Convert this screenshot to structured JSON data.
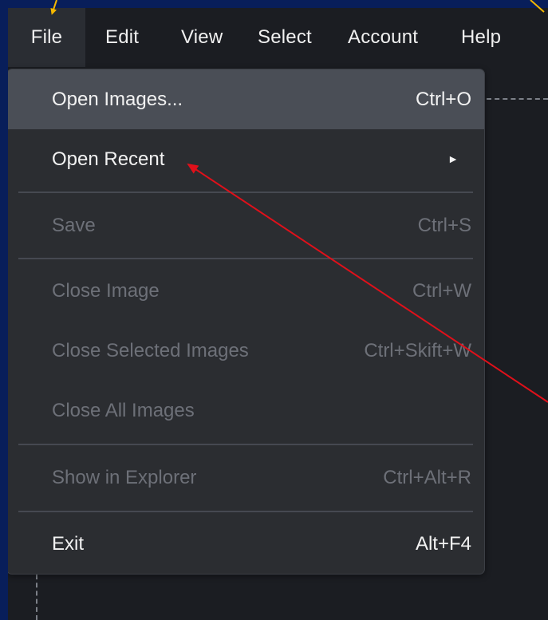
{
  "menubar": {
    "items": [
      {
        "label": "File",
        "active": true
      },
      {
        "label": "Edit"
      },
      {
        "label": "View"
      },
      {
        "label": "Select"
      },
      {
        "label": "Account"
      },
      {
        "label": "Help"
      }
    ]
  },
  "file_menu": {
    "items": [
      {
        "label": "Open Images...",
        "shortcut": "Ctrl+O",
        "enabled": true,
        "highlighted": true
      },
      {
        "label": "Open Recent",
        "submenu_icon": "►",
        "enabled": true
      },
      {
        "label": "Save",
        "shortcut": "Ctrl+S",
        "enabled": false
      },
      {
        "label": "Close Image",
        "shortcut": "Ctrl+W",
        "enabled": false
      },
      {
        "label": "Close Selected Images",
        "shortcut": "Ctrl+Skift+W",
        "enabled": false
      },
      {
        "label": "Close All Images",
        "enabled": false
      },
      {
        "label": "Show in Explorer",
        "shortcut": "Ctrl+Alt+R",
        "enabled": false
      },
      {
        "label": "Exit",
        "shortcut": "Alt+F4",
        "enabled": true
      }
    ]
  },
  "annotations": {
    "highlight_color": "#f5b800",
    "pointer_color": "#e0101a"
  },
  "colors": {
    "outer_background": "#081e5a",
    "app_background": "#1b1d22",
    "menu_background": "#2b2d31",
    "hover_background": "#4a4e56"
  }
}
